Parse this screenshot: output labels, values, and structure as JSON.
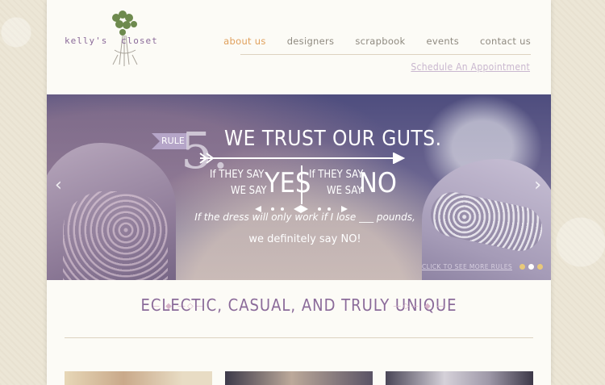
{
  "brand": {
    "logo_text_left": "kelly's",
    "logo_text_right": "closet"
  },
  "nav": {
    "items": [
      {
        "label": "about us",
        "active": true
      },
      {
        "label": "designers",
        "active": false
      },
      {
        "label": "scrapbook",
        "active": false
      },
      {
        "label": "events",
        "active": false
      },
      {
        "label": "contact us",
        "active": false
      }
    ],
    "schedule_link": "Schedule An Appointment"
  },
  "hero": {
    "rule_label": "RULE",
    "rule_number": "5.",
    "headline": "WE TRUST OUR GUTS.",
    "if_they_say_1": "If THEY SAY",
    "we_say_1": "WE SAY",
    "big_1": "YES",
    "if_they_say_2": "If THEY SAY",
    "we_say_2": "WE SAY",
    "big_2": "NO",
    "line1": "If the dress will only work if I lose ___ pounds,",
    "line2": "we definitely say NO!",
    "see_more": "CLICK TO SEE MORE RULES",
    "prev_icon": "‹",
    "next_icon": "›",
    "slides": 3,
    "active_slide": 2
  },
  "tagline": "ECLECTIC, CASUAL, AND TRULY UNIQUE",
  "colors": {
    "accent_orange": "#e0a05c",
    "purple_text": "#8b6b9a",
    "dot_gold": "#e8c97a"
  }
}
